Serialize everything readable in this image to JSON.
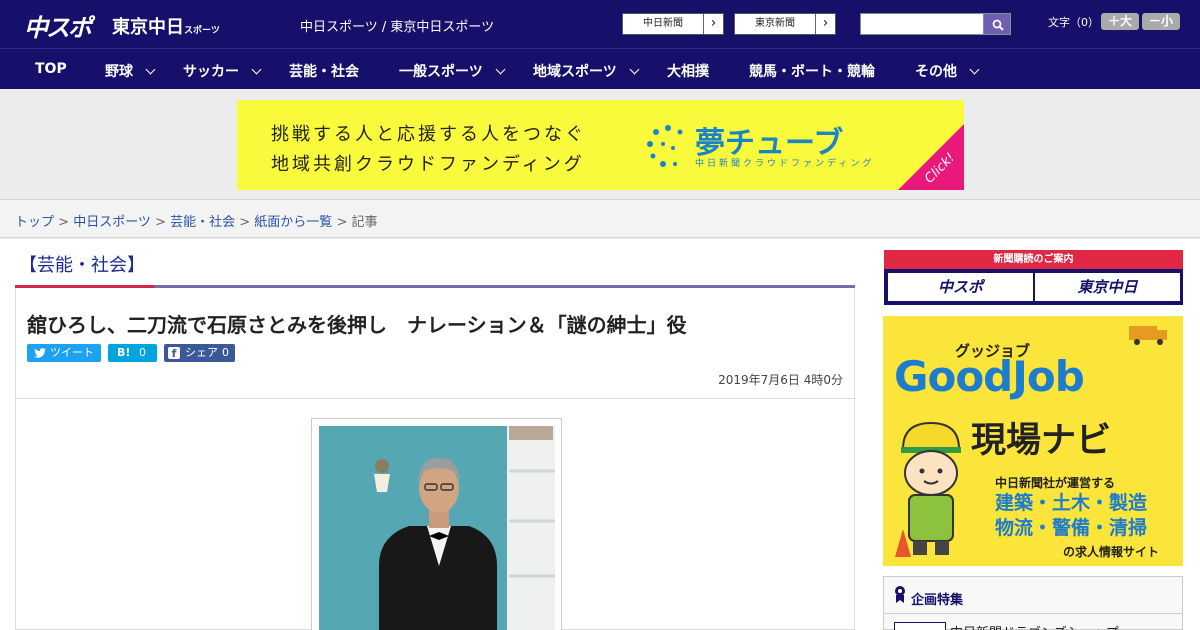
{
  "header": {
    "logo_chuspo": "中スポ",
    "logo_tokyo": "東京中日",
    "logo_tokyo_sub": "スポーツ",
    "site_links": "中日スポーツ / 東京中日スポーツ",
    "chunichi_btn": "中日新聞",
    "tokyo_btn": "東京新聞",
    "search_placeholder": "",
    "fontsize_label": "文字（0）",
    "larger_btn": "＋大",
    "smaller_btn": "－小"
  },
  "nav": {
    "items": [
      "TOP",
      "野球",
      "サッカー",
      "芸能・社会",
      "一般スポーツ",
      "地域スポーツ",
      "大相撲",
      "競馬・ボート・競輪",
      "その他"
    ]
  },
  "banner": {
    "line1": "挑戦する人と応援する人をつなぐ",
    "line2": "地域共創クラウドファンディング",
    "brand": "夢チューブ",
    "brand_sub": "中日新聞クラウドファンディング",
    "click": "Click!"
  },
  "breadcrumb": {
    "items": [
      "トップ",
      "中日スポーツ",
      "芸能・社会",
      "紙面から一覧"
    ],
    "current": "記事"
  },
  "article": {
    "category": "【芸能・社会】",
    "headline": "舘ひろし、二刀流で石原さとみを後押し　ナレーション＆「謎の紳士」役",
    "tweet_label": "ツイート",
    "hatena_label": "B!",
    "hatena_count": "0",
    "facebook_label": "シェア",
    "facebook_count": "0",
    "date": "2019年7月6日 4時0分"
  },
  "sidebar": {
    "subscribe_head": "新聞購読のご案内",
    "sub_chuspo": "中スポ",
    "sub_tokyo": "東京中日",
    "gj_kana": "グッジョブ",
    "gj_title": "GoodJob",
    "gj_navi": "現場ナビ",
    "gj_sub": "中日新聞社が運営する",
    "gj_jobs1": "建築・土木・製造",
    "gj_jobs2": "物流・警備・清掃",
    "gj_foot": "の求人情報サイト",
    "feature_title": "企画特集",
    "feature_item": "中日新聞ドラゴンズショップ"
  },
  "colors": {
    "header_bg": "#16106b",
    "accent_red": "#d2264a",
    "link_blue": "#2a52a6",
    "twitter": "#1da1f2",
    "hatena": "#00a4de",
    "facebook": "#3b5998"
  }
}
